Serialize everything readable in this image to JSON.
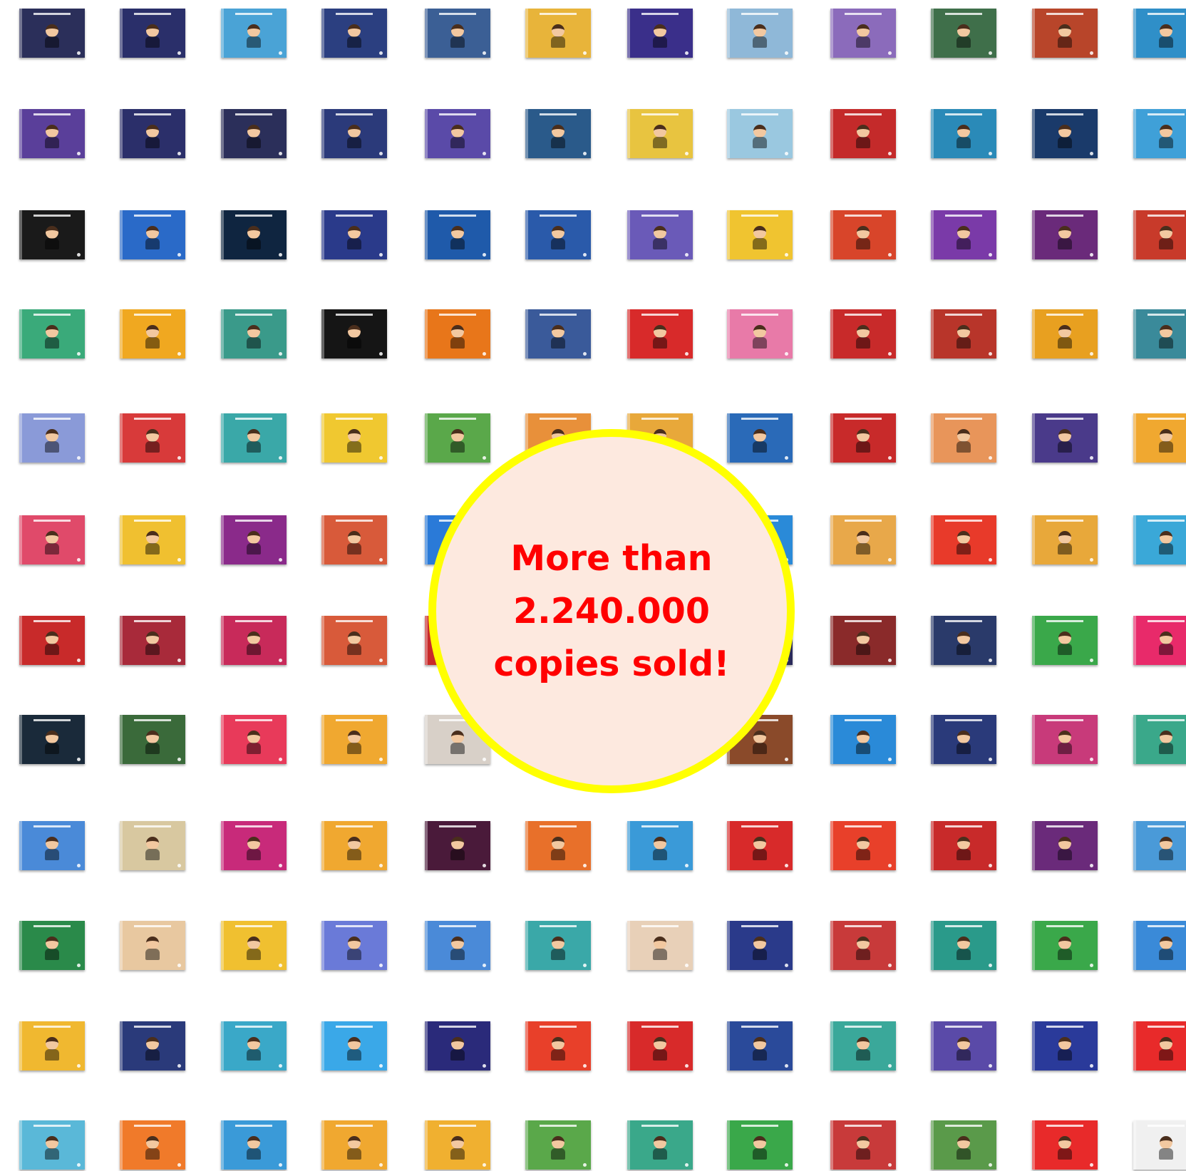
{
  "badge": {
    "text": "More than\n2.240.000\ncopies sold!",
    "text_color": "#ff0000",
    "ring_color": "#ffff00",
    "fill_color": "#fde9df"
  },
  "covers": [
    [
      "#2b2f5a",
      "#2a2f6a",
      "#4aa3d6",
      "#2b3f80",
      "#3b5f95",
      "#e8b43a",
      "#3a2f8a",
      "#8fb8d8",
      "#8b6bbb",
      "#3f6f4a",
      "#b8452a",
      "#2f8fc8"
    ],
    [
      "#5a3f9a",
      "#2b2f6a",
      "#2b2f5a",
      "#2b3a7a",
      "#5a4aa8",
      "#2a5a8a",
      "#e8c440",
      "#9ac8e0",
      "#c42a2a",
      "#2a8ab8",
      "#1a3a6a",
      "#3fa0d8"
    ],
    [
      "#1a1a1a",
      "#2a6ac8",
      "#0f2540",
      "#2a3a8a",
      "#1f5aaa",
      "#2a5aaa",
      "#6a5ab8",
      "#f0c430",
      "#d8452a",
      "#7a3aa8",
      "#6a2a7a",
      "#c83a2a"
    ],
    [
      "#3aaa7a",
      "#f0a820",
      "#3a9a8a",
      "#151515",
      "#e8761a",
      "#3a5a9a",
      "#d82a2a",
      "#e87aa8",
      "#c82a2a",
      "#b8352a",
      "#e8a020",
      "#3a8a9a"
    ],
    [
      "#8a9ad8",
      "#d83a3a",
      "#3aa8a8",
      "#f0c830",
      "#5aa84a",
      "#e8903a",
      "#e8a83a",
      "#2a6ab8",
      "#c82a2a",
      "#e8955a",
      "#4a3a8a",
      "#f0a830"
    ],
    [
      "#e04a6a",
      "#f0c030",
      "#8a2a8a",
      "#d85a3a",
      "#2a7ad8",
      "#ffffff",
      "#ffffff",
      "#2a8ad8",
      "#e8a84a",
      "#e83a2a",
      "#e8a83a",
      "#3aa8d8"
    ],
    [
      "#c82a2a",
      "#a82a3a",
      "#c82a5a",
      "#d85a3a",
      "#c82a2a",
      "#ffffff",
      "#ffffff",
      "#2a2a5a",
      "#8a2a2a",
      "#2a3a6a",
      "#3aa84a",
      "#e82a6a"
    ],
    [
      "#1a2a3a",
      "#3a6a3a",
      "#e83a5a",
      "#f0a830",
      "#d8d0c8",
      "#ffffff",
      "#ffffff",
      "#8a4a2a",
      "#2a8ad8",
      "#2a3a7a",
      "#c83a7a",
      "#3aa88a"
    ],
    [
      "#4a8ad8",
      "#d8c8a0",
      "#c82a7a",
      "#f0a830",
      "#4a1a3a",
      "#e8702a",
      "#3a9ad8",
      "#d82a2a",
      "#e8402a",
      "#c82a2a",
      "#6a2a7a",
      "#4a9ad8"
    ],
    [
      "#2a8a4a",
      "#e8c8a0",
      "#f0c030",
      "#6a7ad8",
      "#4a8ad8",
      "#3aa8a8",
      "#e8d0b8",
      "#2a3a8a",
      "#c83a3a",
      "#2a9a8a",
      "#3aa84a",
      "#3a8ad8"
    ],
    [
      "#f0b830",
      "#2a3a7a",
      "#3aa8c8",
      "#3aa8e8",
      "#2a2a7a",
      "#e8402a",
      "#d82a2a",
      "#2a4a9a",
      "#3aa89a",
      "#5a4aa8",
      "#2a3a9a",
      "#e82a2a"
    ],
    [
      "#5ab8d8",
      "#f07a2a",
      "#3a9ad8",
      "#f0a830",
      "#f0b030",
      "#5aa84a",
      "#3aa88a",
      "#3aa84a",
      "#c83a3a",
      "#5a9a4a",
      "#e82a2a",
      "#f0f0f0"
    ]
  ]
}
